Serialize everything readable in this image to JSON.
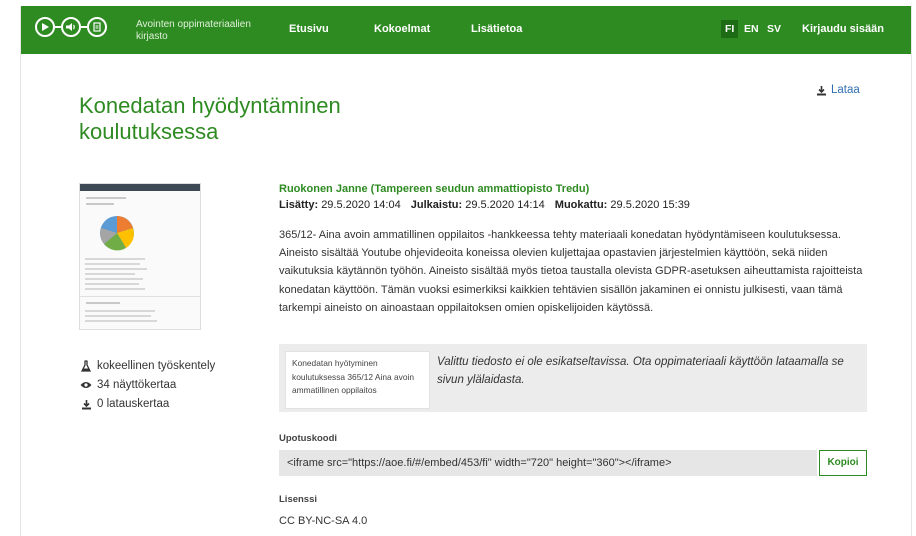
{
  "header": {
    "brand": "Avointen oppimateriaalien kirjasto",
    "nav": [
      "Etusivu",
      "Kokoelmat",
      "Lisätietoa"
    ],
    "languages": [
      "FI",
      "EN",
      "SV"
    ],
    "active_language": "FI",
    "login": "Kirjaudu sisään",
    "logo_icons": [
      "play-icon",
      "audio-icon",
      "document-icon"
    ]
  },
  "page": {
    "title": "Konedatan hyödyntäminen koulutuksessa",
    "download": "Lataa"
  },
  "sidebar": {
    "stats": [
      {
        "icon": "flask-icon",
        "text": "kokeellinen työskentely"
      },
      {
        "icon": "eye-icon",
        "text": "34 näyttökertaa"
      },
      {
        "icon": "download-icon",
        "text": "0 latauskertaa"
      }
    ]
  },
  "material": {
    "author": "Ruokonen Janne (Tampereen seudun ammattiopisto Tredu)",
    "added_label": "Lisätty:",
    "added": "29.5.2020 14:04",
    "published_label": "Julkaistu:",
    "published": "29.5.2020 14:14",
    "modified_label": "Muokattu:",
    "modified": "29.5.2020 15:39",
    "description": "365/12- Aina avoin ammatillinen oppilaitos -hankkeessa tehty materiaali konedatan hyödyntämiseen koulutuksessa. Aineisto sisältää Youtube ohjevideoita koneissa olevien kuljettajaa opastavien järjestelmien käyttöön, sekä niiden vaikutuksia käytännön työhön. Aineisto sisältää myös tietoa taustalla olevista GDPR-asetuksen aiheuttamista rajoitteista konedatan käyttöön. Tämän vuoksi esimerkiksi kaikkien tehtävien sisällön jakaminen ei onnistu julkisesti, vaan tämä tarkempi aineisto on ainoastaan oppilaitoksen omien opiskelijoiden käytössä."
  },
  "preview": {
    "file_name": "Konedatan hyötyminen koulutuksessa 365/12 Aina avoin ammatillinen oppilaitos",
    "message": "Valittu tiedosto ei ole esikatseltavissa. Ota oppimateriaali käyttöön lataamalla se sivun ylälaidasta."
  },
  "embed": {
    "label": "Upotuskoodi",
    "code": "<iframe src=\"https://aoe.fi/#/embed/453/fi\" width=\"720\" height=\"360\"></iframe>",
    "copy_label": "Kopioi"
  },
  "license": {
    "label": "Lisenssi",
    "value": "CC BY-NC-SA 4.0"
  },
  "colors": {
    "brand_green": "#2e8b22",
    "link_blue": "#2f6fb0"
  }
}
